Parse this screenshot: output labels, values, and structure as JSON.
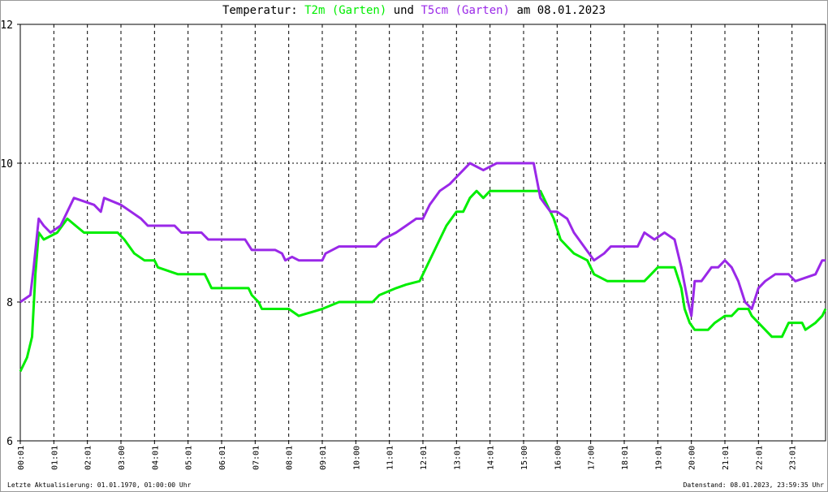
{
  "chart_data": {
    "type": "line",
    "title": {
      "prefix": "Temperatur:",
      "series1": "T2m (Garten)",
      "mid": "und",
      "series2": "T5cm (Garten)",
      "suffix": "am 08.01.2023"
    },
    "ylim": [
      6,
      12
    ],
    "yticks": [
      "6",
      "8",
      "10",
      "12"
    ],
    "xlim": [
      0,
      24
    ],
    "xticks": [
      {
        "h": 0,
        "label": "00:01"
      },
      {
        "h": 1,
        "label": "01:01"
      },
      {
        "h": 2,
        "label": "02:01"
      },
      {
        "h": 3,
        "label": "03:00"
      },
      {
        "h": 4,
        "label": "04:01"
      },
      {
        "h": 5,
        "label": "05:01"
      },
      {
        "h": 6,
        "label": "06:01"
      },
      {
        "h": 7,
        "label": "07:01"
      },
      {
        "h": 8,
        "label": "08:01"
      },
      {
        "h": 9,
        "label": "09:01"
      },
      {
        "h": 10,
        "label": "10:00"
      },
      {
        "h": 11,
        "label": "11:01"
      },
      {
        "h": 12,
        "label": "12:01"
      },
      {
        "h": 13,
        "label": "13:01"
      },
      {
        "h": 14,
        "label": "14:01"
      },
      {
        "h": 15,
        "label": "15:00"
      },
      {
        "h": 16,
        "label": "16:00"
      },
      {
        "h": 17,
        "label": "17:00"
      },
      {
        "h": 18,
        "label": "18:01"
      },
      {
        "h": 19,
        "label": "19:01"
      },
      {
        "h": 20,
        "label": "20:00"
      },
      {
        "h": 21,
        "label": "21:01"
      },
      {
        "h": 22,
        "label": "22:01"
      },
      {
        "h": 23,
        "label": "23:01"
      }
    ],
    "grid": true,
    "series": [
      {
        "name": "T2m (Garten)",
        "color": "#00ee00",
        "points": [
          [
            0,
            7.0
          ],
          [
            0.2,
            7.2
          ],
          [
            0.35,
            7.5
          ],
          [
            0.45,
            8.4
          ],
          [
            0.55,
            9.0
          ],
          [
            0.7,
            8.9
          ],
          [
            1.1,
            9.0
          ],
          [
            1.4,
            9.2
          ],
          [
            1.65,
            9.1
          ],
          [
            1.9,
            9.0
          ],
          [
            2.9,
            9.0
          ],
          [
            3.1,
            8.9
          ],
          [
            3.4,
            8.7
          ],
          [
            3.7,
            8.6
          ],
          [
            4.0,
            8.6
          ],
          [
            4.1,
            8.5
          ],
          [
            4.7,
            8.4
          ],
          [
            5.5,
            8.4
          ],
          [
            5.6,
            8.3
          ],
          [
            5.7,
            8.2
          ],
          [
            6.8,
            8.2
          ],
          [
            6.9,
            8.1
          ],
          [
            7.1,
            8.0
          ],
          [
            7.2,
            7.9
          ],
          [
            8.0,
            7.9
          ],
          [
            8.3,
            7.8
          ],
          [
            9.0,
            7.9
          ],
          [
            9.5,
            8.0
          ],
          [
            10.5,
            8.0
          ],
          [
            10.7,
            8.1
          ],
          [
            11.2,
            8.2
          ],
          [
            11.5,
            8.25
          ],
          [
            11.9,
            8.3
          ],
          [
            12.0,
            8.4
          ],
          [
            12.4,
            8.8
          ],
          [
            12.7,
            9.1
          ],
          [
            13.0,
            9.3
          ],
          [
            13.2,
            9.3
          ],
          [
            13.4,
            9.5
          ],
          [
            13.6,
            9.6
          ],
          [
            13.8,
            9.5
          ],
          [
            14.0,
            9.6
          ],
          [
            15.5,
            9.6
          ],
          [
            15.7,
            9.4
          ],
          [
            15.9,
            9.2
          ],
          [
            16.1,
            8.9
          ],
          [
            16.3,
            8.8
          ],
          [
            16.5,
            8.7
          ],
          [
            16.9,
            8.6
          ],
          [
            17.1,
            8.4
          ],
          [
            17.5,
            8.3
          ],
          [
            18.6,
            8.3
          ],
          [
            18.8,
            8.4
          ],
          [
            19.0,
            8.5
          ],
          [
            19.5,
            8.5
          ],
          [
            19.7,
            8.2
          ],
          [
            19.8,
            7.9
          ],
          [
            19.95,
            7.7
          ],
          [
            20.1,
            7.6
          ],
          [
            20.5,
            7.6
          ],
          [
            20.7,
            7.7
          ],
          [
            21.0,
            7.8
          ],
          [
            21.2,
            7.8
          ],
          [
            21.4,
            7.9
          ],
          [
            21.7,
            7.9
          ],
          [
            21.8,
            7.8
          ],
          [
            22.0,
            7.7
          ],
          [
            22.2,
            7.6
          ],
          [
            22.4,
            7.5
          ],
          [
            22.7,
            7.5
          ],
          [
            22.9,
            7.7
          ],
          [
            23.3,
            7.7
          ],
          [
            23.4,
            7.6
          ],
          [
            23.7,
            7.7
          ],
          [
            23.9,
            7.8
          ],
          [
            24,
            7.9
          ]
        ]
      },
      {
        "name": "T5cm (Garten)",
        "color": "#9a28e8",
        "points": [
          [
            0,
            8.0
          ],
          [
            0.3,
            8.1
          ],
          [
            0.4,
            8.5
          ],
          [
            0.55,
            9.2
          ],
          [
            0.7,
            9.1
          ],
          [
            0.9,
            9.0
          ],
          [
            1.2,
            9.1
          ],
          [
            1.4,
            9.3
          ],
          [
            1.6,
            9.5
          ],
          [
            2.2,
            9.4
          ],
          [
            2.4,
            9.3
          ],
          [
            2.5,
            9.5
          ],
          [
            3.0,
            9.4
          ],
          [
            3.3,
            9.3
          ],
          [
            3.6,
            9.2
          ],
          [
            3.8,
            9.1
          ],
          [
            4.6,
            9.1
          ],
          [
            4.8,
            9.0
          ],
          [
            5.4,
            9.0
          ],
          [
            5.6,
            8.9
          ],
          [
            6.7,
            8.9
          ],
          [
            6.9,
            8.75
          ],
          [
            7.6,
            8.75
          ],
          [
            7.8,
            8.7
          ],
          [
            7.9,
            8.6
          ],
          [
            8.1,
            8.65
          ],
          [
            8.3,
            8.6
          ],
          [
            9.0,
            8.6
          ],
          [
            9.1,
            8.7
          ],
          [
            9.5,
            8.8
          ],
          [
            10.6,
            8.8
          ],
          [
            10.8,
            8.9
          ],
          [
            11.2,
            9.0
          ],
          [
            11.5,
            9.1
          ],
          [
            11.8,
            9.2
          ],
          [
            12.0,
            9.2
          ],
          [
            12.2,
            9.4
          ],
          [
            12.5,
            9.6
          ],
          [
            12.8,
            9.7
          ],
          [
            13.0,
            9.8
          ],
          [
            13.2,
            9.9
          ],
          [
            13.4,
            10.0
          ],
          [
            13.8,
            9.9
          ],
          [
            14.2,
            10.0
          ],
          [
            15.3,
            10.0
          ],
          [
            15.5,
            9.5
          ],
          [
            15.8,
            9.3
          ],
          [
            16.0,
            9.3
          ],
          [
            16.3,
            9.2
          ],
          [
            16.5,
            9.0
          ],
          [
            16.8,
            8.8
          ],
          [
            17.1,
            8.6
          ],
          [
            17.4,
            8.7
          ],
          [
            17.6,
            8.8
          ],
          [
            18.4,
            8.8
          ],
          [
            18.6,
            9.0
          ],
          [
            18.9,
            8.9
          ],
          [
            19.2,
            9.0
          ],
          [
            19.5,
            8.9
          ],
          [
            19.7,
            8.5
          ],
          [
            19.9,
            8.0
          ],
          [
            20.0,
            7.8
          ],
          [
            20.1,
            8.3
          ],
          [
            20.3,
            8.3
          ],
          [
            20.6,
            8.5
          ],
          [
            20.8,
            8.5
          ],
          [
            21.0,
            8.6
          ],
          [
            21.2,
            8.5
          ],
          [
            21.4,
            8.3
          ],
          [
            21.6,
            8.0
          ],
          [
            21.8,
            7.9
          ],
          [
            22.0,
            8.2
          ],
          [
            22.2,
            8.3
          ],
          [
            22.5,
            8.4
          ],
          [
            22.9,
            8.4
          ],
          [
            23.1,
            8.3
          ],
          [
            23.7,
            8.4
          ],
          [
            23.9,
            8.6
          ],
          [
            24,
            8.6
          ]
        ]
      }
    ]
  },
  "footer": {
    "left": "Letzte Aktualisierung: 01.01.1970, 01:00:00 Uhr",
    "right": "Datenstand: 08.01.2023, 23:59:35 Uhr"
  }
}
